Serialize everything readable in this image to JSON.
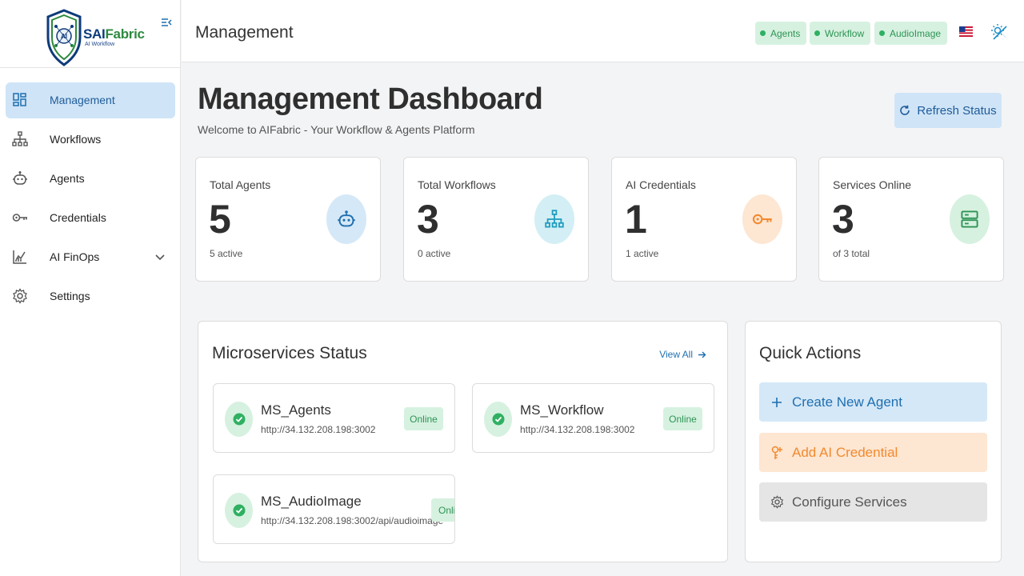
{
  "app": {
    "logo_sai": "SAI",
    "logo_fabric": "Fabric",
    "logo_sub": "AI Workflow",
    "logo_badge": "AI"
  },
  "sidebar": {
    "items": [
      {
        "label": "Management",
        "icon": "dashboard-icon",
        "active": true
      },
      {
        "label": "Workflows",
        "icon": "hierarchy-icon"
      },
      {
        "label": "Agents",
        "icon": "robot-icon"
      },
      {
        "label": "Credentials",
        "icon": "key-icon"
      },
      {
        "label": "AI FinOps",
        "icon": "finops-chart-icon",
        "expandable": true
      },
      {
        "label": "Settings",
        "icon": "gear-icon"
      }
    ]
  },
  "header": {
    "title": "Management",
    "chips": [
      "Agents",
      "Workflow",
      "AudioImage"
    ],
    "language_flag": "us-flag-icon",
    "theme_toggle_icon": "theme-toggle-icon"
  },
  "main": {
    "title": "Management Dashboard",
    "subtitle": "Welcome to AIFabric - Your Workflow & Agents Platform",
    "refresh_label": "Refresh Status"
  },
  "stats": [
    {
      "label": "Total Agents",
      "value": "5",
      "sub": "5 active",
      "icon": "robot-icon",
      "color": "#d5e8f7"
    },
    {
      "label": "Total Workflows",
      "value": "3",
      "sub": "0 active",
      "icon": "hierarchy-icon",
      "color": "#d3eff5"
    },
    {
      "label": "AI Credentials",
      "value": "1",
      "sub": "1 active",
      "icon": "key-icon",
      "color": "#fde6d2"
    },
    {
      "label": "Services Online",
      "value": "3",
      "sub": "of 3 total",
      "icon": "server-icon",
      "color": "#d6f1e0"
    }
  ],
  "microservices": {
    "title": "Microservices Status",
    "view_all": "View All",
    "services": [
      {
        "name": "MS_Agents",
        "url": "http://34.132.208.198:3002",
        "status": "Online"
      },
      {
        "name": "MS_Workflow",
        "url": "http://34.132.208.198:3002",
        "status": "Online"
      },
      {
        "name": "MS_AudioImage",
        "url": "http://34.132.208.198:3002/api/audioimage",
        "status": "Online"
      }
    ]
  },
  "quick_actions": {
    "title": "Quick Actions",
    "buttons": [
      {
        "label": "Create New Agent",
        "icon": "plus-icon",
        "bg": "#d5e8f7",
        "fg": "#1f6fb0"
      },
      {
        "label": "Add AI Credential",
        "icon": "key-plus-icon",
        "bg": "#fde6d2",
        "fg": "#f28a2e"
      },
      {
        "label": "Configure Services",
        "icon": "gear-icon",
        "bg": "#e5e5e5",
        "fg": "#555555"
      }
    ]
  }
}
